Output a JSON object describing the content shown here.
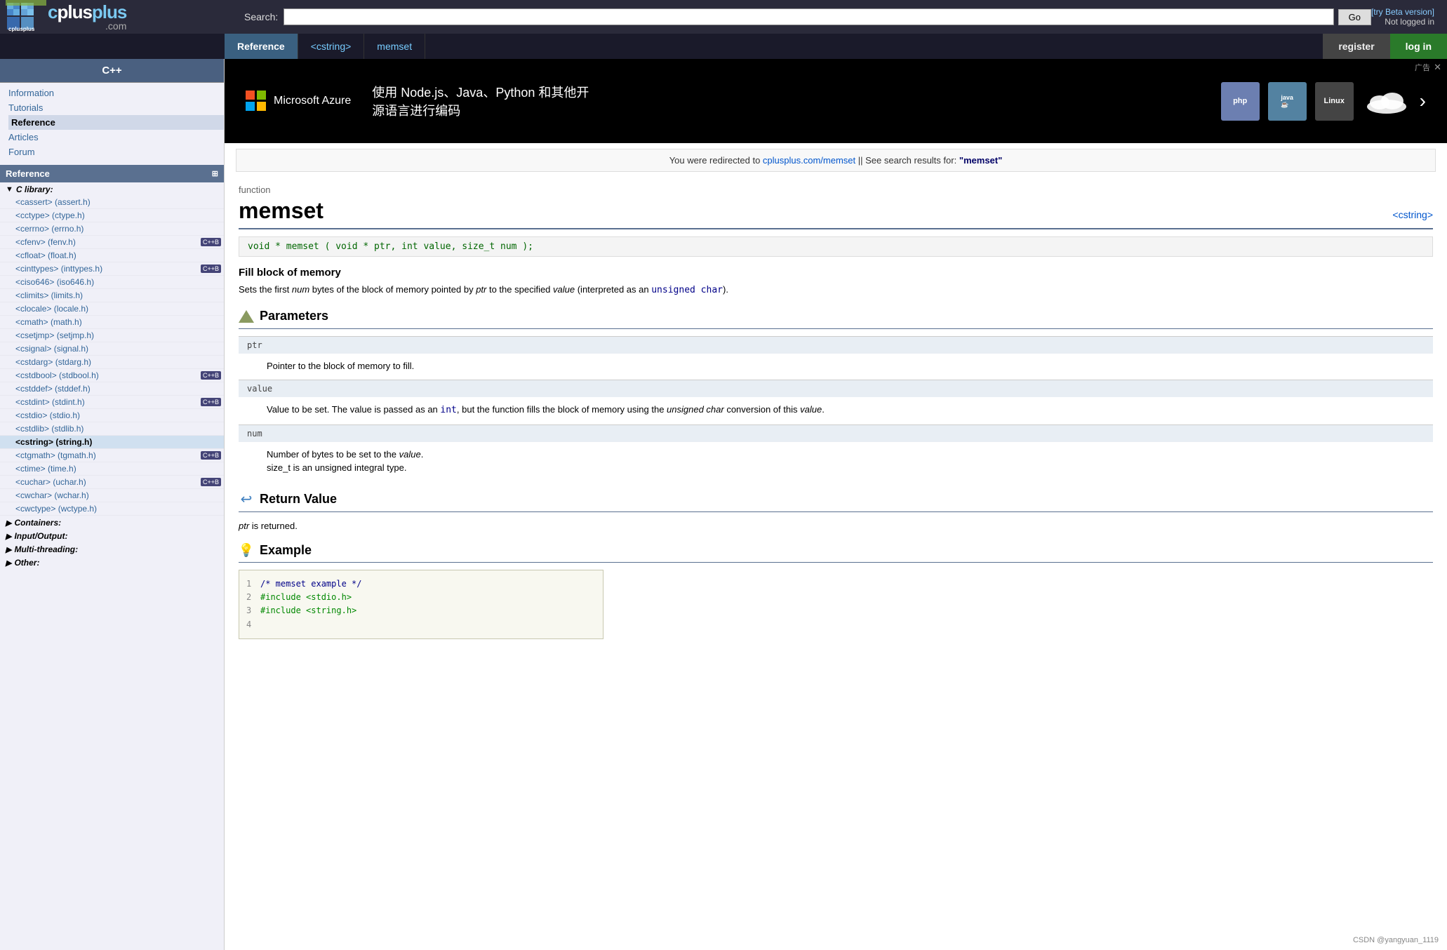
{
  "header": {
    "logo_name": "cplusplus",
    "logo_suffix": ".com",
    "search_label": "Search:",
    "search_placeholder": "",
    "search_button": "Go",
    "try_beta": "[try Beta version]",
    "not_logged": "Not logged in",
    "register_label": "register",
    "login_label": "log in"
  },
  "nav": {
    "tabs": [
      {
        "label": "Reference",
        "active": true
      },
      {
        "label": "<cstring>",
        "active": false
      },
      {
        "label": "memset",
        "active": false
      }
    ],
    "register": "register",
    "login": "log in"
  },
  "sidebar_cpp": {
    "title": "C++",
    "links": [
      {
        "label": "Information",
        "href": "#"
      },
      {
        "label": "Tutorials",
        "href": "#"
      },
      {
        "label": "Reference",
        "href": "#",
        "active": true
      },
      {
        "label": "Articles",
        "href": "#"
      },
      {
        "label": "Forum",
        "href": "#"
      }
    ]
  },
  "sidebar_ref": {
    "title": "Reference",
    "c_library_label": "C library:",
    "items": [
      {
        "label": "<cassert> (assert.h)",
        "href": "#"
      },
      {
        "label": "<cctype> (ctype.h)",
        "href": "#"
      },
      {
        "label": "<cerrno> (errno.h)",
        "href": "#"
      },
      {
        "label": "<cfenv> (fenv.h)",
        "href": "#",
        "badge": "C++B"
      },
      {
        "label": "<cfloat> (float.h)",
        "href": "#"
      },
      {
        "label": "<cinttypes> (inttypes.h)",
        "href": "#",
        "badge": "C++B"
      },
      {
        "label": "<ciso646> (iso646.h)",
        "href": "#"
      },
      {
        "label": "<climits> (limits.h)",
        "href": "#"
      },
      {
        "label": "<clocale> (locale.h)",
        "href": "#"
      },
      {
        "label": "<cmath> (math.h)",
        "href": "#"
      },
      {
        "label": "<csetjmp> (setjmp.h)",
        "href": "#"
      },
      {
        "label": "<csignal> (signal.h)",
        "href": "#"
      },
      {
        "label": "<cstdarg> (stdarg.h)",
        "href": "#"
      },
      {
        "label": "<cstdbool> (stdbool.h)",
        "href": "#",
        "badge": "C++B"
      },
      {
        "label": "<cstddef> (stddef.h)",
        "href": "#"
      },
      {
        "label": "<cstdint> (stdint.h)",
        "href": "#",
        "badge": "C++B"
      },
      {
        "label": "<cstdio> (stdio.h)",
        "href": "#"
      },
      {
        "label": "<cstdlib> (stdlib.h)",
        "href": "#"
      },
      {
        "label": "<cstring> (string.h)",
        "href": "#",
        "active": true
      },
      {
        "label": "<ctgmath> (tgmath.h)",
        "href": "#",
        "badge": "C++B"
      },
      {
        "label": "<ctime> (time.h)",
        "href": "#"
      },
      {
        "label": "<cuchar> (uchar.h)",
        "href": "#",
        "badge": "C++B"
      },
      {
        "label": "<cwchar> (wchar.h)",
        "href": "#"
      },
      {
        "label": "<cwctype> (wctype.h)",
        "href": "#"
      }
    ],
    "categories": [
      {
        "label": "Containers:",
        "expanded": false
      },
      {
        "label": "Input/Output:",
        "expanded": false
      },
      {
        "label": "Multi-threading:",
        "expanded": false
      },
      {
        "label": "Other:",
        "expanded": false
      }
    ]
  },
  "ad": {
    "ms_text": "Microsoft Azure",
    "ad_text_line1": "使用 Node.js、Java、Python 和其他开",
    "ad_text_line2": "源语言进行编码",
    "label": "广告",
    "icons": [
      "php",
      "java",
      "linux"
    ]
  },
  "redirect": {
    "text_before": "You were redirected to ",
    "link_text": "cplusplus.com/memset",
    "link_href": "#",
    "text_middle": " || See search results for: ",
    "search_term": "\"memset\""
  },
  "function": {
    "type": "function",
    "name": "memset",
    "header_tag": "<cstring>",
    "signature": "void * memset ( void * ptr, int value, size_t num );",
    "desc_title": "Fill block of memory",
    "desc_text": "Sets the first ",
    "desc_num": "num",
    "desc_text2": " bytes of the block of memory pointed by ",
    "desc_ptr": "ptr",
    "desc_text3": " to the specified ",
    "desc_value": "value",
    "desc_text4": " (interpreted as an ",
    "desc_uchar": "unsigned char",
    "desc_text5": ").",
    "params_title": "Parameters",
    "params": [
      {
        "name": "ptr",
        "desc": "Pointer to the block of memory to fill."
      },
      {
        "name": "value",
        "desc_parts": [
          "Value to be set. The value is passed as an ",
          "int",
          ", but the function fills the block of memory using the ",
          "unsigned char",
          " conversion of this ",
          "value",
          "."
        ]
      },
      {
        "name": "num",
        "desc_parts": [
          "Number of bytes to be set to the ",
          "value",
          ".\nsize_t is an unsigned integral type."
        ]
      }
    ],
    "return_title": "Return Value",
    "return_text": "ptr",
    "return_text2": " is returned.",
    "example_title": "Example",
    "example_lines": [
      {
        "num": "1",
        "content": "/* memset example */",
        "type": "comment"
      },
      {
        "num": "2",
        "content": "#include <stdio.h>",
        "type": "include"
      },
      {
        "num": "3",
        "content": "#include <string.h>",
        "type": "include"
      },
      {
        "num": "4",
        "content": "",
        "type": "normal"
      }
    ]
  },
  "watermark": "CSDN @yangyuan_1119"
}
